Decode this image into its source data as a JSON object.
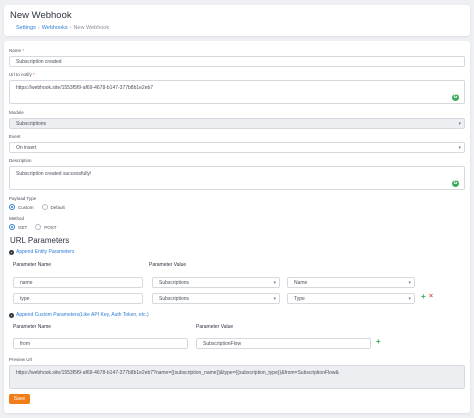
{
  "header": {
    "title": "New Webhook",
    "breadcrumb": [
      "Settings",
      "Webhooks",
      "New Webhook"
    ]
  },
  "form": {
    "name": {
      "label": "Name",
      "value": "Subscription created"
    },
    "url": {
      "label": "Url to notify",
      "value": "https://webhook.site/1553f5f9-af69-4678-b147-377b8b1e2eb7"
    },
    "module": {
      "label": "Module",
      "value": "Subscriptions"
    },
    "event": {
      "label": "Event",
      "value": "On insert"
    },
    "description": {
      "label": "Description",
      "value": "Subscription created successfully!"
    },
    "payload_type": {
      "label": "Payload Type",
      "options": [
        "Custom",
        "Default"
      ],
      "selected": "Custom"
    },
    "method": {
      "label": "Method",
      "options": [
        "GET",
        "POST"
      ],
      "selected": "GET"
    }
  },
  "url_params": {
    "title": "URL Parameters",
    "append_entity_label": "Append Entity Parameters",
    "entity_headers": {
      "name": "Parameter Name",
      "value": "Parameter Value"
    },
    "entity_rows": [
      {
        "name": "name",
        "module": "Subscriptions",
        "field": "Name"
      },
      {
        "name": "type",
        "module": "Subscriptions",
        "field": "Type"
      }
    ],
    "append_custom_label": "Append Custom Parameters(Like API Key, Auth Token, etc.)",
    "custom_headers": {
      "name": "Parameter Name",
      "value": "Parameter Value"
    },
    "custom_rows": [
      {
        "name": "from",
        "value": "SubscriptionFlow"
      }
    ]
  },
  "preview": {
    "label": "Preview Url",
    "value": "https://webhook.site/1553f5f9-af69-4678-b147-377b8b1e2eb7?name={{subscription_name}}&type={{subscription_type}}&from=SubscriptionFlow&"
  },
  "save_label": "Save",
  "colors": {
    "accent": "#2f7fd6",
    "save": "#f07d18",
    "add": "#3aa859",
    "remove": "#d9534f"
  }
}
